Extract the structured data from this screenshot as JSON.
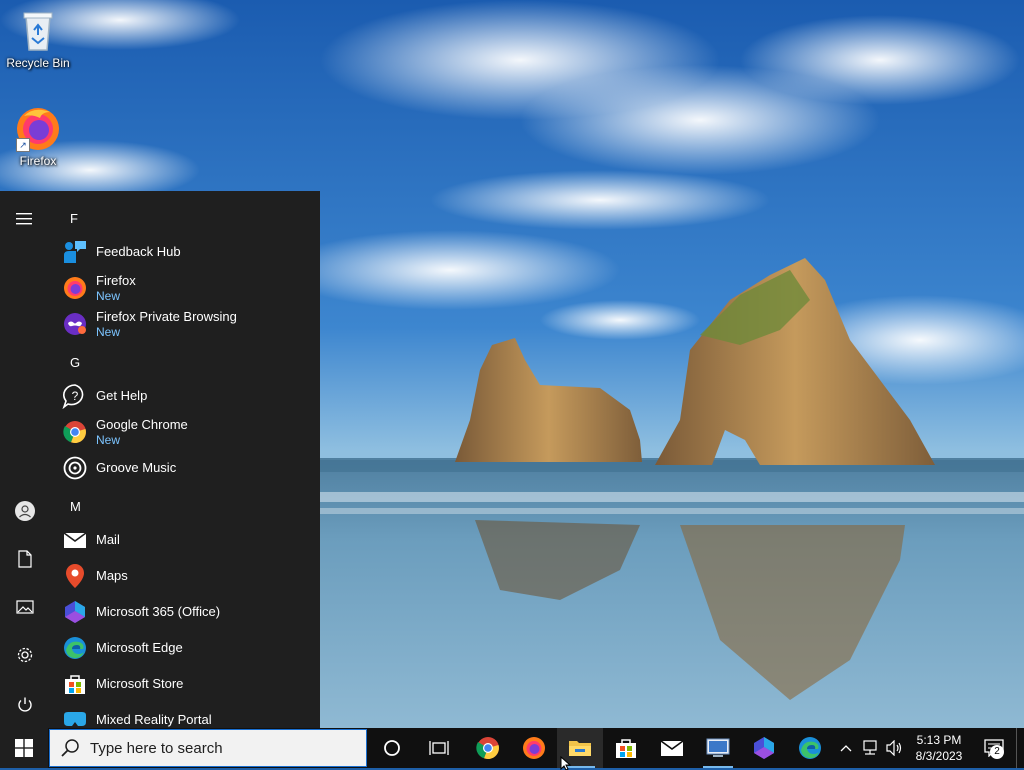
{
  "desktop": {
    "icons": [
      {
        "label": "Recycle Bin",
        "icon": "recycle-bin-icon"
      },
      {
        "label": "Firefox",
        "icon": "firefox-icon"
      }
    ]
  },
  "start_menu": {
    "rail": [
      "hamburger-icon",
      "user-icon",
      "documents-icon",
      "pictures-icon",
      "settings-icon",
      "power-icon"
    ],
    "sections": [
      {
        "letter": "F",
        "apps": [
          {
            "name": "Feedback Hub",
            "sub": "",
            "icon": "feedback-hub-icon"
          },
          {
            "name": "Firefox",
            "sub": "New",
            "icon": "firefox-icon"
          },
          {
            "name": "Firefox Private Browsing",
            "sub": "New",
            "icon": "firefox-private-icon"
          }
        ]
      },
      {
        "letter": "G",
        "apps": [
          {
            "name": "Get Help",
            "sub": "",
            "icon": "get-help-icon"
          },
          {
            "name": "Google Chrome",
            "sub": "New",
            "icon": "chrome-icon"
          },
          {
            "name": "Groove Music",
            "sub": "",
            "icon": "groove-music-icon"
          }
        ]
      },
      {
        "letter": "M",
        "apps": [
          {
            "name": "Mail",
            "sub": "",
            "icon": "mail-icon"
          },
          {
            "name": "Maps",
            "sub": "",
            "icon": "maps-icon"
          },
          {
            "name": "Microsoft 365 (Office)",
            "sub": "",
            "icon": "office-icon"
          },
          {
            "name": "Microsoft Edge",
            "sub": "",
            "icon": "edge-icon"
          },
          {
            "name": "Microsoft Store",
            "sub": "",
            "icon": "store-icon"
          },
          {
            "name": "Mixed Reality Portal",
            "sub": "",
            "icon": "mixed-reality-icon"
          }
        ]
      }
    ]
  },
  "taskbar": {
    "search_placeholder": "Type here to search",
    "pinned": [
      "cortana-icon",
      "task-view-icon",
      "chrome-icon",
      "firefox-icon",
      "file-explorer-icon",
      "store-icon",
      "mail-icon",
      "remote-desktop-icon",
      "office-icon",
      "edge-icon"
    ],
    "tray": {
      "time": "5:13 PM",
      "date": "8/3/2023",
      "notification_count": "2"
    }
  },
  "colors": {
    "accent": "#76b9ed",
    "start_bg": "#1f1f1f",
    "taskbar_bg": "#101010",
    "new_badge": "#7cc4ff"
  }
}
